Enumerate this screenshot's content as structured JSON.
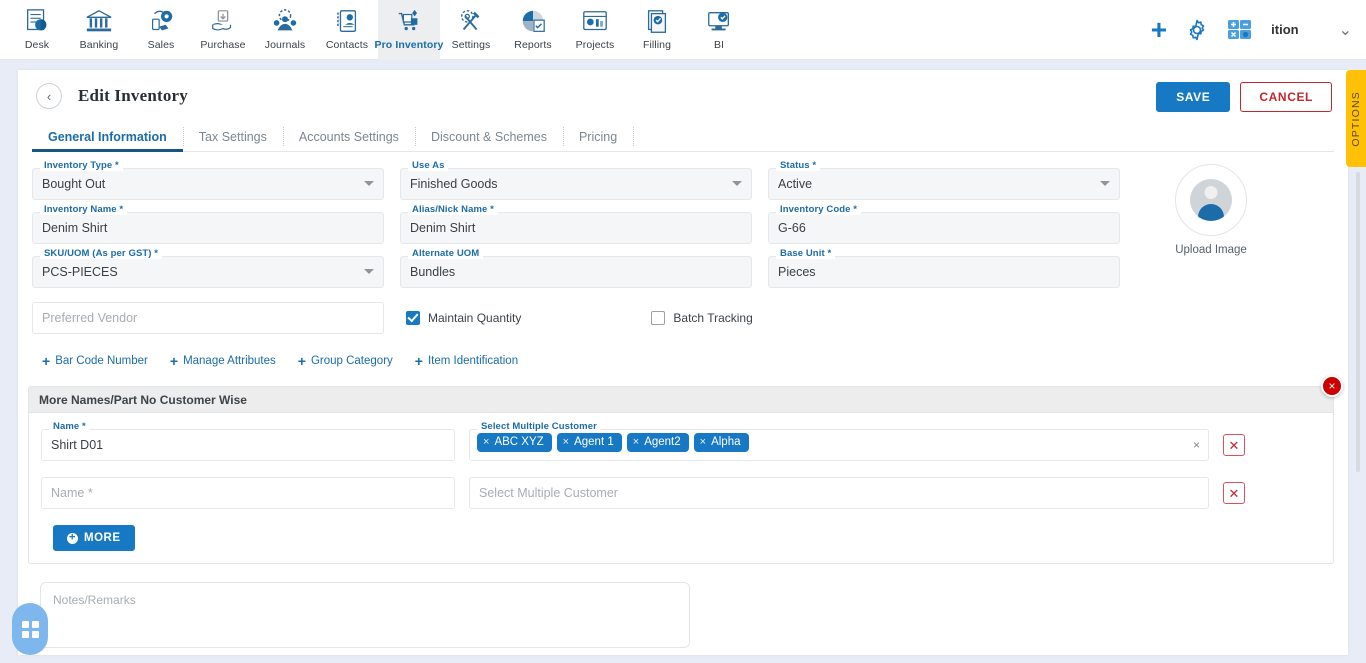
{
  "topnav": {
    "items": [
      {
        "label": "Desk",
        "icon": "desk-icon"
      },
      {
        "label": "Banking",
        "icon": "bank-icon"
      },
      {
        "label": "Sales",
        "icon": "sales-icon"
      },
      {
        "label": "Purchase",
        "icon": "purchase-icon"
      },
      {
        "label": "Journals",
        "icon": "journals-icon"
      },
      {
        "label": "Contacts",
        "icon": "contacts-icon"
      },
      {
        "label": "Pro Inventory",
        "icon": "inventory-icon"
      },
      {
        "label": "Settings",
        "icon": "settings-tools-icon"
      },
      {
        "label": "Reports",
        "icon": "reports-icon"
      },
      {
        "label": "Projects",
        "icon": "projects-icon"
      },
      {
        "label": "Filling",
        "icon": "filling-icon"
      },
      {
        "label": "BI",
        "icon": "bi-icon"
      }
    ],
    "active_index": 6,
    "org_name": "ition",
    "accent": "#1778c4"
  },
  "header": {
    "back_label": "‹",
    "title": "Edit Inventory",
    "save_label": "SAVE",
    "cancel_label": "CANCEL"
  },
  "tabs": [
    {
      "label": "General Information",
      "active": true
    },
    {
      "label": "Tax Settings",
      "active": false
    },
    {
      "label": "Accounts Settings",
      "active": false
    },
    {
      "label": "Discount & Schemes",
      "active": false
    },
    {
      "label": "Pricing",
      "active": false
    }
  ],
  "form": {
    "inventory_type": {
      "label": "Inventory Type *",
      "value": "Bought Out"
    },
    "use_as": {
      "label": "Use As",
      "value": "Finished Goods"
    },
    "status": {
      "label": "Status *",
      "value": "Active"
    },
    "inventory_name": {
      "label": "Inventory Name *",
      "value": "Denim Shirt"
    },
    "alias_name": {
      "label": "Alias/Nick Name *",
      "value": "Denim Shirt"
    },
    "inventory_code": {
      "label": "Inventory Code *",
      "value": "G-66"
    },
    "sku_uom": {
      "label": "SKU/UOM (As per GST) *",
      "value": "PCS-PIECES"
    },
    "alternate_uom": {
      "label": "Alternate UOM",
      "value": "Bundles"
    },
    "base_unit": {
      "label": "Base Unit *",
      "value": "Pieces"
    },
    "preferred_vendor": {
      "placeholder": "Preferred Vendor",
      "value": ""
    },
    "maintain_quantity": {
      "label": "Maintain Quantity",
      "checked": true
    },
    "batch_tracking": {
      "label": "Batch Tracking",
      "checked": false
    },
    "upload_image_label": "Upload Image",
    "add_links": [
      {
        "label": "Bar Code Number"
      },
      {
        "label": "Manage Attributes"
      },
      {
        "label": "Group Category"
      },
      {
        "label": "Item Identification"
      }
    ]
  },
  "panel": {
    "title": "More Names/Part No Customer Wise",
    "close_label": "×",
    "rows": [
      {
        "name_label": "Name *",
        "name_value": "Shirt D01",
        "customer_label": "Select Multiple Customer",
        "customer_placeholder": "",
        "chips": [
          "ABC XYZ",
          "Agent 1",
          "Agent2",
          "Alpha"
        ],
        "clear_label": "×",
        "delete_label": "✕"
      },
      {
        "name_label": "",
        "name_value": "",
        "name_placeholder": "Name *",
        "customer_label": "",
        "customer_placeholder": "Select Multiple Customer",
        "chips": [],
        "delete_label": "✕"
      }
    ],
    "more_button": "MORE"
  },
  "notes": {
    "placeholder": "Notes/Remarks",
    "value": ""
  },
  "options_tab": {
    "label": "OPTIONS",
    "color": "#ffc107"
  },
  "fab": {
    "name": "apps-grid-fab"
  }
}
